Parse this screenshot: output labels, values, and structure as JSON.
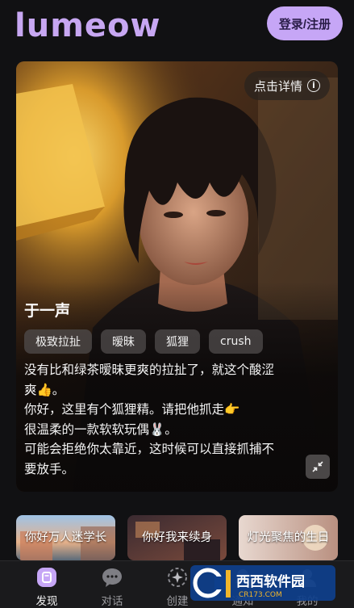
{
  "header": {
    "logo": "lumeow",
    "login_label": "登录/注册"
  },
  "hero": {
    "detail_label": "点击详情",
    "character_name": "于一声",
    "tags": [
      "极致拉扯",
      "暧昧",
      "狐狸",
      "crush"
    ],
    "description": [
      "没有比和绿茶暧昧更爽的拉扯了，就这个酸涩",
      "爽👍。",
      "你好，这里有个狐狸精。请把他抓走👉",
      "很温柔的一款软软玩偶🐰。",
      "可能会拒绝你太靠近，这时候可以直接抓捕不",
      "要放手。"
    ]
  },
  "stories": [
    {
      "label": "你好万人迷学长"
    },
    {
      "label": "你好我来续身"
    },
    {
      "label": "灯光聚焦的生日"
    }
  ],
  "nav": [
    {
      "label": "发现",
      "icon": "discover-icon",
      "active": true
    },
    {
      "label": "对话",
      "icon": "chat-bubble-icon",
      "active": false
    },
    {
      "label": "创建",
      "icon": "create-sparkle-icon",
      "active": false
    },
    {
      "label": "通知",
      "icon": "bell-icon",
      "active": false
    },
    {
      "label": "我的",
      "icon": "profile-icon",
      "active": false
    }
  ],
  "watermark": {
    "text": "西西软件园",
    "sub": "CR173.COM"
  },
  "colors": {
    "accent": "#c6a6f6",
    "background": "#111113",
    "nav_bg": "#1a1a1c"
  }
}
